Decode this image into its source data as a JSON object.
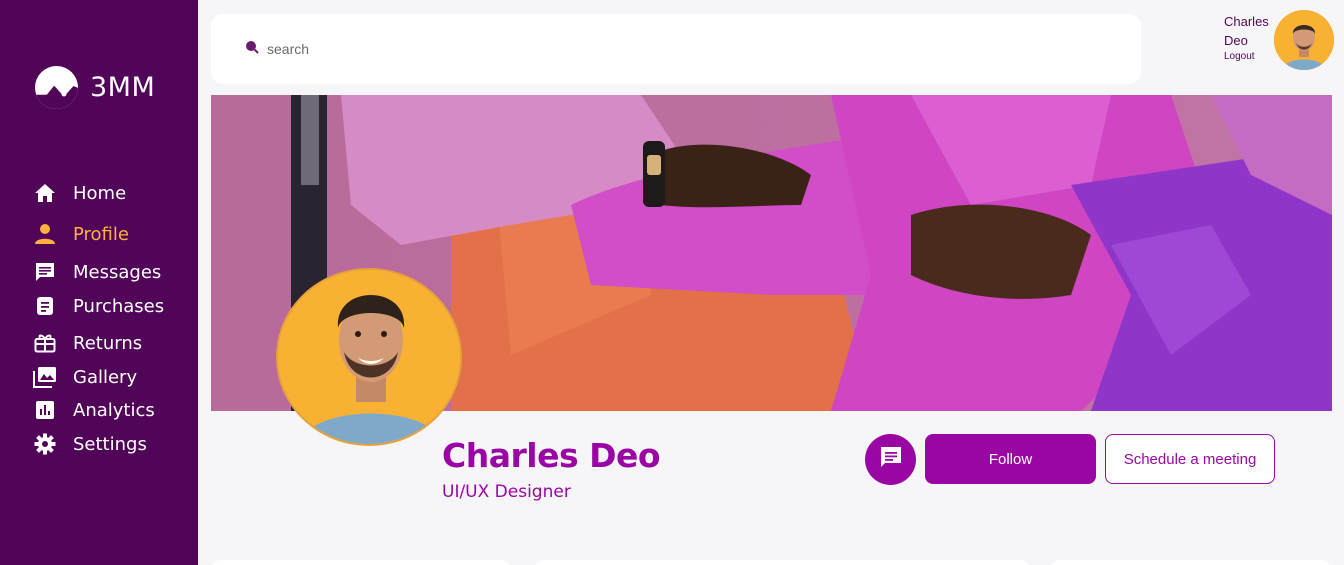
{
  "brand": {
    "name": "3MM"
  },
  "nav": {
    "items": [
      {
        "label": "Home",
        "icon": "home-icon",
        "active": false
      },
      {
        "label": "Profile",
        "icon": "person-icon",
        "active": true
      },
      {
        "label": "Messages",
        "icon": "message-icon",
        "active": false
      },
      {
        "label": "Purchases",
        "icon": "receipt-icon",
        "active": false
      },
      {
        "label": "Returns",
        "icon": "gift-icon",
        "active": false
      },
      {
        "label": "Gallery",
        "icon": "photo-library-icon",
        "active": false
      },
      {
        "label": "Analytics",
        "icon": "bar-chart-icon",
        "active": false
      },
      {
        "label": "Settings",
        "icon": "gear-icon",
        "active": false
      }
    ]
  },
  "search": {
    "placeholder": "search",
    "value": ""
  },
  "user": {
    "first_name": "Charles",
    "last_name": "Deo",
    "logout_label": "Logout"
  },
  "profile": {
    "name": "Charles Deo",
    "role": "UI/UX Designer"
  },
  "actions": {
    "message_icon": "chat-icon",
    "follow_label": "Follow",
    "schedule_label": "Schedule a meeting"
  },
  "colors": {
    "sidebar": "#510558",
    "accent": "#9a06a4",
    "active_nav": "#fbb040",
    "avatar_bg": "#f8b133"
  }
}
